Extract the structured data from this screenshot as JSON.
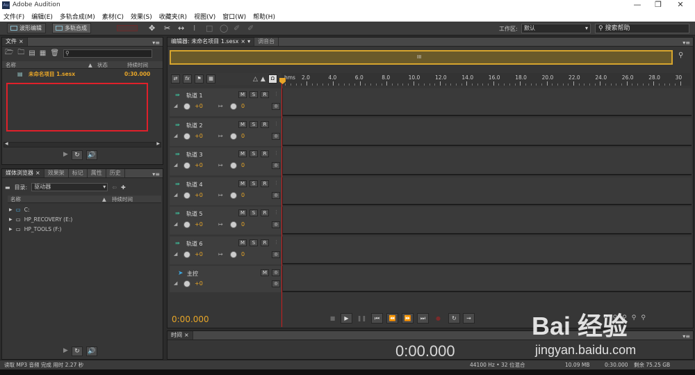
{
  "app": {
    "title": "Adobe Audition",
    "icon_text": "Au"
  },
  "menu": [
    "文件(F)",
    "编辑(E)",
    "多轨合成(M)",
    "素材(C)",
    "效果(S)",
    "收藏夹(R)",
    "视图(V)",
    "窗口(W)",
    "帮助(H)"
  ],
  "toolbar": {
    "waveform_label": "波形编辑",
    "multitrack_label": "多轨合成",
    "workspace_label": "工作区:",
    "workspace_value": "默认",
    "help_search": "搜索帮助"
  },
  "files_panel": {
    "tab": "文件",
    "col_name": "名称",
    "col_status": "状态",
    "col_duration": "持续时间",
    "items": [
      {
        "name": "未命名项目 1.sesx",
        "duration": "0:30.000"
      }
    ]
  },
  "browser_panel": {
    "tabs": [
      "媒体浏览器",
      "效果架",
      "标记",
      "属性",
      "历史"
    ],
    "dir_label": "目录:",
    "dir_value": "驱动器",
    "col_name": "名称",
    "col_duration": "持续时间",
    "drives": [
      "C:",
      "HP_RECOVERY (E:)",
      "HP_TOOLS (F:)"
    ]
  },
  "editor": {
    "tab": "编辑器: 未命名项目 1.sesx",
    "mixer_tab": "调音台",
    "ruler_unit": "hms",
    "ruler_ticks": [
      "2.0",
      "4.0",
      "6.0",
      "8.0",
      "10.0",
      "12.0",
      "14.0",
      "16.0",
      "18.0",
      "20.0",
      "22.0",
      "24.0",
      "26.0",
      "28.0",
      "30"
    ],
    "tracks": [
      {
        "name": "轨道 1",
        "vol": "+0",
        "pan": "0"
      },
      {
        "name": "轨道 2",
        "vol": "+0",
        "pan": "0"
      },
      {
        "name": "轨道 3",
        "vol": "+0",
        "pan": "0"
      },
      {
        "name": "轨道 4",
        "vol": "+0",
        "pan": "0"
      },
      {
        "name": "轨道 5",
        "vol": "+0",
        "pan": "0"
      },
      {
        "name": "轨道 6",
        "vol": "+0",
        "pan": "0"
      }
    ],
    "master": {
      "name": "主控",
      "vol": "+0"
    },
    "m_label": "M",
    "s_label": "S",
    "r_label": "R",
    "timecode": "0:00.000"
  },
  "time_panel": {
    "tab": "时间",
    "value": "0:00.000"
  },
  "status": {
    "left": "读取 MP3 音频 完成 用时 2.27 秒",
    "format": "44100 Hz • 32 位混合",
    "size": "10.09 MB",
    "duration": "0:30.000",
    "free": "剩余 75.25 GB"
  },
  "watermark": {
    "text": "Bai 经验",
    "url": "jingyan.baidu.com"
  },
  "colors": {
    "accent": "#e8a628",
    "highlight": "#e0202a",
    "track_icon": "#3fc7a0"
  }
}
